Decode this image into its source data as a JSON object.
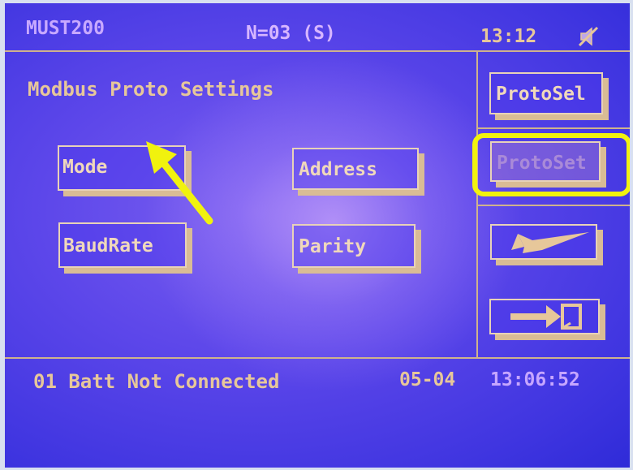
{
  "header": {
    "app_name": "MUST200",
    "unit_indicator": "N=03 (S)",
    "time": "13:12",
    "status_icon": "no-audio-icon"
  },
  "screen": {
    "title": "Modbus Proto Settings"
  },
  "buttons": {
    "mode": "Mode",
    "address": "Address",
    "baudrate": "BaudRate",
    "parity": "Parity"
  },
  "side_panel": {
    "protosel": "ProtoSel",
    "protoset": "ProtoSet",
    "back_icon": "back-arrow-icon",
    "exit_icon": "exit-arrow-icon"
  },
  "footer": {
    "status_message": "01 Batt Not Connected",
    "date": "05-04",
    "clock": "13:06:52"
  },
  "annotations": {
    "highlight_color": "#f1f20e",
    "arrow_color": "#f1f20e"
  },
  "colors": {
    "screen_bg": "#5d47ea",
    "text": "#e7c79a"
  }
}
